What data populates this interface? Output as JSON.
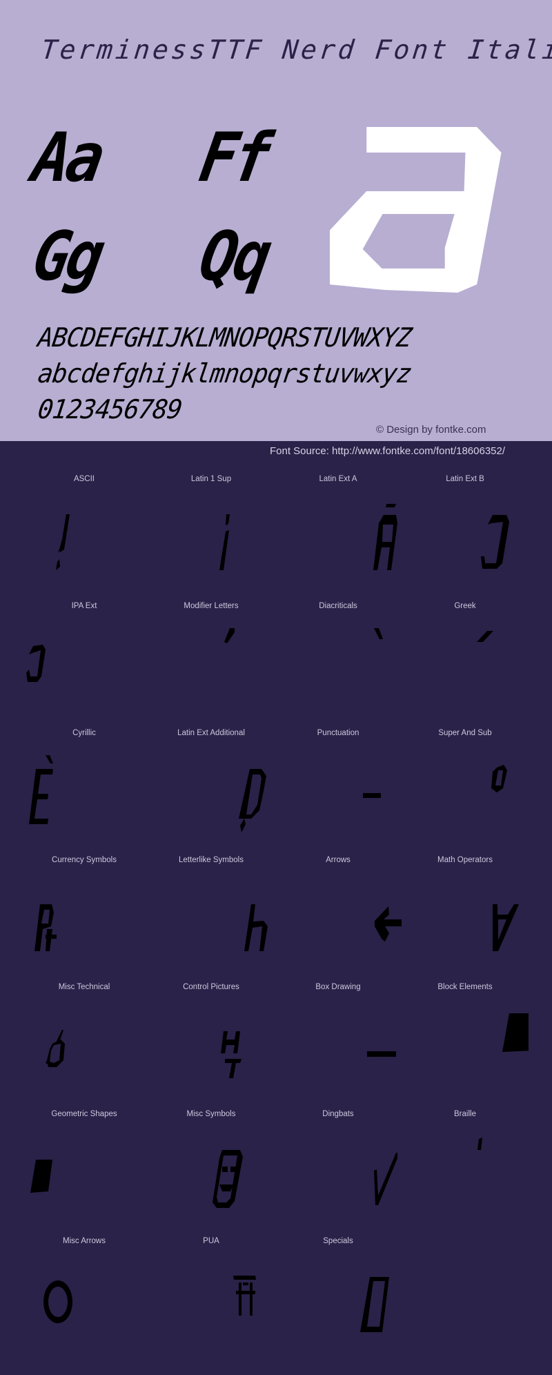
{
  "header": {
    "title": "TerminessTTF Nerd Font Italic"
  },
  "specimen": {
    "pairs": [
      "Aa",
      "Ff",
      "Gg",
      "Qq"
    ],
    "big_glyph": "a",
    "uppercase": "ABCDEFGHIJKLMNOPQRSTUVWXYZ",
    "lowercase": "abcdefghijklmnopqrstuvwxyz",
    "digits": "0123456789",
    "credit": "© Design by fontke.com"
  },
  "source": {
    "text": "Font Source: http://www.fontke.com/font/18606352/"
  },
  "colors": {
    "hero_bg": "#b8aed2",
    "page_bg": "#2a2248",
    "glyph": "#000000",
    "big_glyph": "#ffffff"
  },
  "blocks": [
    {
      "label": "ASCII",
      "glyph": "!"
    },
    {
      "label": "Latin 1 Sup",
      "glyph": "¡"
    },
    {
      "label": "Latin Ext A",
      "glyph": "Ā"
    },
    {
      "label": "Latin Ext B",
      "glyph": "Ɔ"
    },
    {
      "label": "IPA Ext",
      "glyph": "ɔ"
    },
    {
      "label": "Modifier Letters",
      "glyph": "ʹ"
    },
    {
      "label": "Diacriticals",
      "glyph": "̀"
    },
    {
      "label": "Greek",
      "glyph": "ʹ"
    },
    {
      "label": "Cyrillic",
      "glyph": "Ѐ"
    },
    {
      "label": "Latin Ext Additional",
      "glyph": "Ḍ"
    },
    {
      "label": "Punctuation",
      "glyph": "‐"
    },
    {
      "label": "Super And Sub",
      "glyph": "⁰"
    },
    {
      "label": "Currency Symbols",
      "glyph": "₧"
    },
    {
      "label": "Letterlike Symbols",
      "glyph": "ℎ"
    },
    {
      "label": "Arrows",
      "glyph": "←"
    },
    {
      "label": "Math Operators",
      "glyph": "∀"
    },
    {
      "label": "Misc Technical",
      "glyph": "⌀"
    },
    {
      "label": "Control Pictures",
      "glyph": "␉"
    },
    {
      "label": "Box Drawing",
      "glyph": "─"
    },
    {
      "label": "Block Elements",
      "glyph": "▀"
    },
    {
      "label": "Geometric Shapes",
      "glyph": "■"
    },
    {
      "label": "Misc Symbols",
      "glyph": "☺"
    },
    {
      "label": "Dingbats",
      "glyph": "✓"
    },
    {
      "label": "Braille",
      "glyph": "⠁"
    },
    {
      "label": "Misc Arrows",
      "glyph": "⭘"
    },
    {
      "label": "PUA",
      "glyph": "⛩"
    },
    {
      "label": "Specials",
      "glyph": "�"
    }
  ]
}
